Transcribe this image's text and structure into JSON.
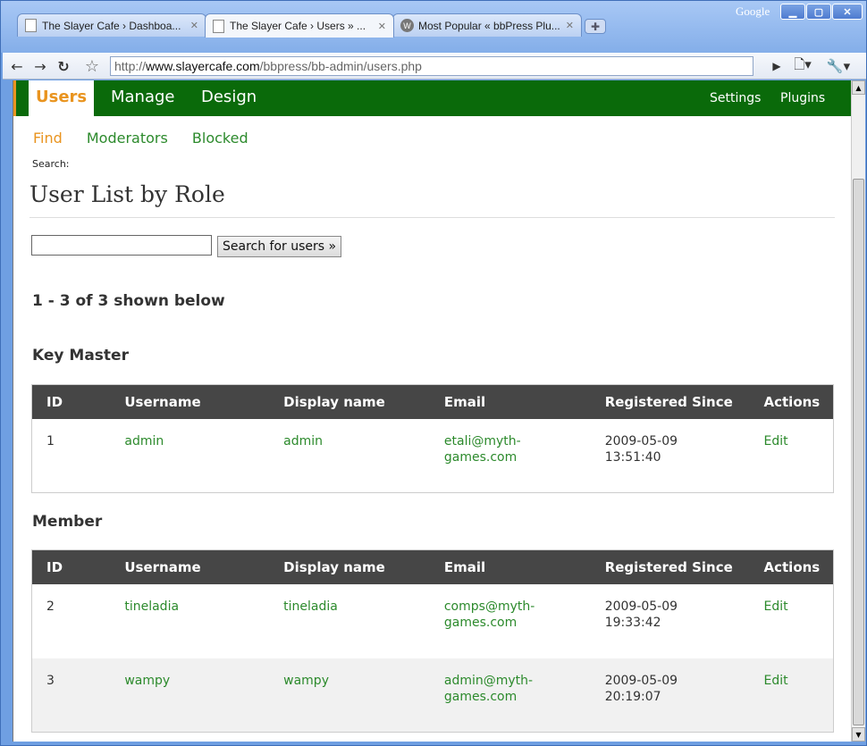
{
  "browser": {
    "tabs": [
      {
        "label": "The Slayer Cafe › Dashboa...",
        "active": false
      },
      {
        "label": "The Slayer Cafe › Users » ...",
        "active": true
      },
      {
        "label": "Most Popular « bbPress Plu...",
        "active": false
      }
    ],
    "google_label": "Google",
    "url_prefix": "http://",
    "url_domain": "www.slayercafe.com",
    "url_path": "/bbpress/bb-admin/users.php"
  },
  "admin_nav": {
    "primary": [
      "Users",
      "Manage",
      "Design"
    ],
    "secondary": [
      "Settings",
      "Plugins"
    ]
  },
  "sub_nav": [
    "Find",
    "Moderators",
    "Blocked"
  ],
  "search_label": "Search:",
  "page_title": "User List by Role",
  "search": {
    "value": "",
    "button": "Search for users »"
  },
  "results_count": "1 - 3 of 3 shown below",
  "table_headers": [
    "ID",
    "Username",
    "Display name",
    "Email",
    "Registered Since",
    "Actions"
  ],
  "roles": [
    {
      "name": "Key Master",
      "users": [
        {
          "id": "1",
          "username": "admin",
          "display_name": "admin",
          "email_1": "etali@myth-",
          "email_2": "games.com",
          "registered_1": "2009-05-09",
          "registered_2": "13:51:40",
          "action": "Edit"
        }
      ]
    },
    {
      "name": "Member",
      "users": [
        {
          "id": "2",
          "username": "tineladia",
          "display_name": "tineladia",
          "email_1": "comps@myth-",
          "email_2": "games.com",
          "registered_1": "2009-05-09",
          "registered_2": "19:33:42",
          "action": "Edit"
        },
        {
          "id": "3",
          "username": "wampy",
          "display_name": "wampy",
          "email_1": "admin@myth-",
          "email_2": "games.com",
          "registered_1": "2009-05-09",
          "registered_2": "20:19:07",
          "action": "Edit"
        }
      ]
    }
  ],
  "colors": {
    "admin_green": "#0a6a0a",
    "accent_orange": "#e9941f",
    "link_green": "#2c8a2c",
    "table_header": "#464646"
  }
}
